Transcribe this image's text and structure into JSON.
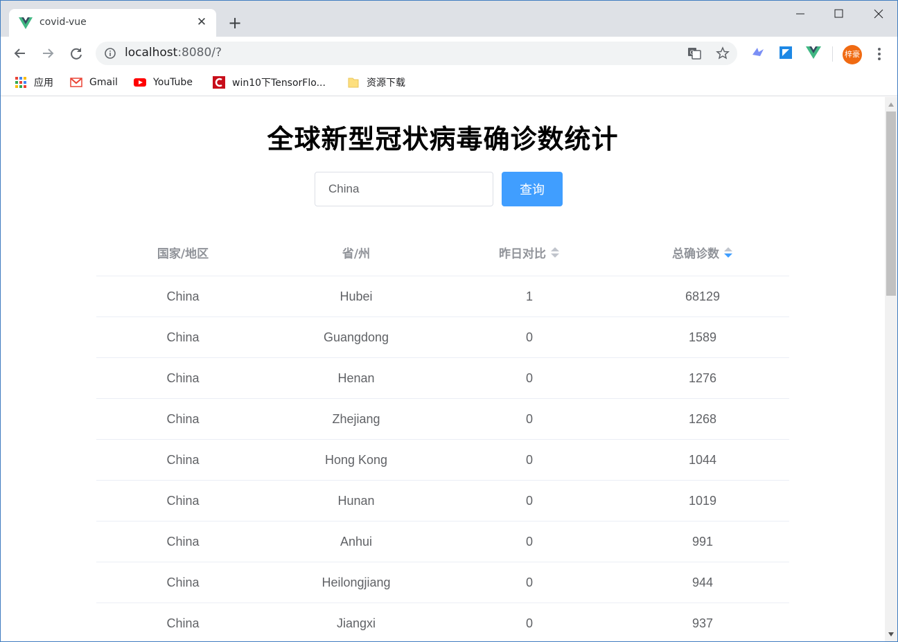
{
  "browser": {
    "tab_title": "covid-vue",
    "url_host": "localhost",
    "url_rest": ":8080/?",
    "avatar_text": "梓豪",
    "bookmarks": [
      {
        "label": "应用",
        "icon": "apps-grid-icon"
      },
      {
        "label": "Gmail",
        "icon": "gmail-icon"
      },
      {
        "label": "YouTube",
        "icon": "youtube-icon"
      },
      {
        "label": "win10下TensorFlo...",
        "icon": "csdn-icon"
      },
      {
        "label": "资源下载",
        "icon": "folder-icon"
      }
    ]
  },
  "page": {
    "title": "全球新型冠状病毒确诊数统计",
    "search": {
      "value": "China",
      "button_label": "查询"
    },
    "table": {
      "headers": [
        "国家/地区",
        "省/州",
        "昨日对比",
        "总确诊数"
      ],
      "rows": [
        [
          "China",
          "Hubei",
          "1",
          "68129"
        ],
        [
          "China",
          "Guangdong",
          "0",
          "1589"
        ],
        [
          "China",
          "Henan",
          "0",
          "1276"
        ],
        [
          "China",
          "Zhejiang",
          "0",
          "1268"
        ],
        [
          "China",
          "Hong Kong",
          "0",
          "1044"
        ],
        [
          "China",
          "Hunan",
          "0",
          "1019"
        ],
        [
          "China",
          "Anhui",
          "0",
          "991"
        ],
        [
          "China",
          "Heilongjiang",
          "0",
          "944"
        ],
        [
          "China",
          "Jiangxi",
          "0",
          "937"
        ]
      ]
    }
  },
  "colors": {
    "primary": "#409eff",
    "header_text": "#909399",
    "cell_text": "#606266"
  }
}
